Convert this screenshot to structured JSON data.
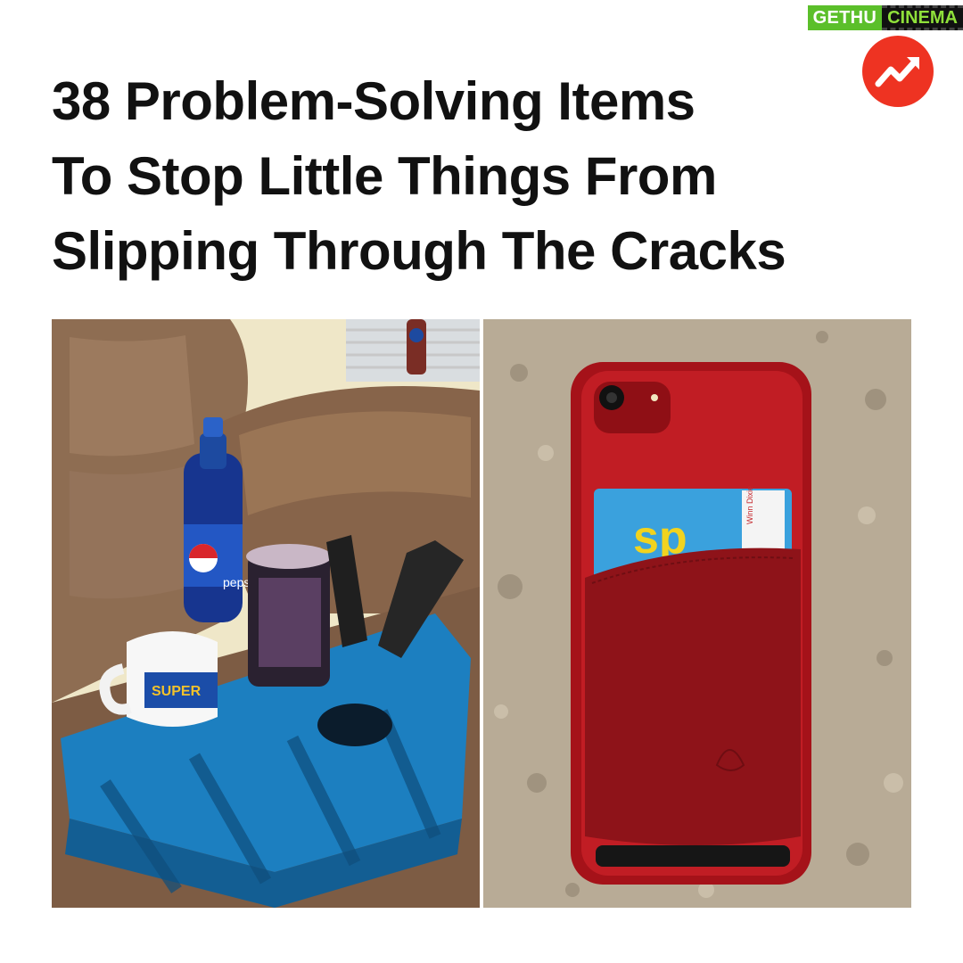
{
  "headline": {
    "line1": "38 Problem-Solving Items",
    "line2": "To Stop Little Things From",
    "line3": "Slipping Through The Cracks"
  },
  "watermark": {
    "left": "GETHU",
    "right": "CINEMA"
  },
  "logo": {
    "icon": "trending-arrow-icon",
    "color": "#ee3322"
  },
  "left_photo": {
    "subject": "couch-cup-holder-pillow",
    "mug_text": "SUPER",
    "bottle_text": "pepsi",
    "colors": {
      "pillow": "#1b78b8",
      "couch": "#8a6a4f",
      "wall": "#efe7c8"
    }
  },
  "right_photo": {
    "subject": "phone-wallet-case",
    "card_text": "sp",
    "card_side_text": "Winn Dixie",
    "colors": {
      "case": "#b0161e",
      "pocket": "#8e1319",
      "counter": "#b8ab96"
    }
  }
}
